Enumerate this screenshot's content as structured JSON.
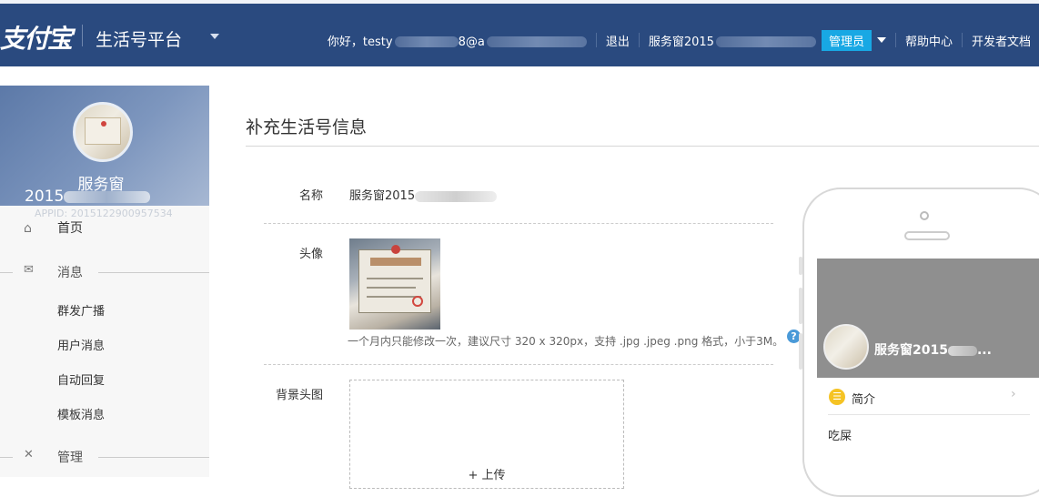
{
  "header": {
    "logo": "支付宝",
    "platform": "生活号平台",
    "greeting": "你好，testy",
    "greeting_suffix": "8@a",
    "logout": "退出",
    "account": "服务窗2015",
    "role": "管理员",
    "help": "帮助中心",
    "dev_docs": "开发者文档"
  },
  "sidebar": {
    "profile_name": "服务窗",
    "profile_id_prefix": "2015",
    "app_id": "APPID: 2015122900957534",
    "home": "首页",
    "groups": [
      {
        "label": "消息",
        "items": [
          "群发广播",
          "用户消息",
          "自动回复",
          "模板消息"
        ]
      },
      {
        "label": "管理",
        "items": []
      }
    ]
  },
  "main": {
    "title": "补充生活号信息",
    "name_label": "名称",
    "name_value": "服务窗2015",
    "avatar_label": "头像",
    "avatar_hint": "一个月内只能修改一次，建议尺寸 320 x 320px，支持 .jpg .jpeg .png 格式，小于3M。",
    "bg_label": "背景头图",
    "upload_label": "+ 上传"
  },
  "preview": {
    "name": "服务窗2015",
    "name_suffix": "...",
    "intro": "简介",
    "footer": "吃屎"
  },
  "colors": {
    "header_bg": "#2a4a7f",
    "accent": "#18a8e4",
    "sidebar_bg": "#f7f7f7"
  }
}
